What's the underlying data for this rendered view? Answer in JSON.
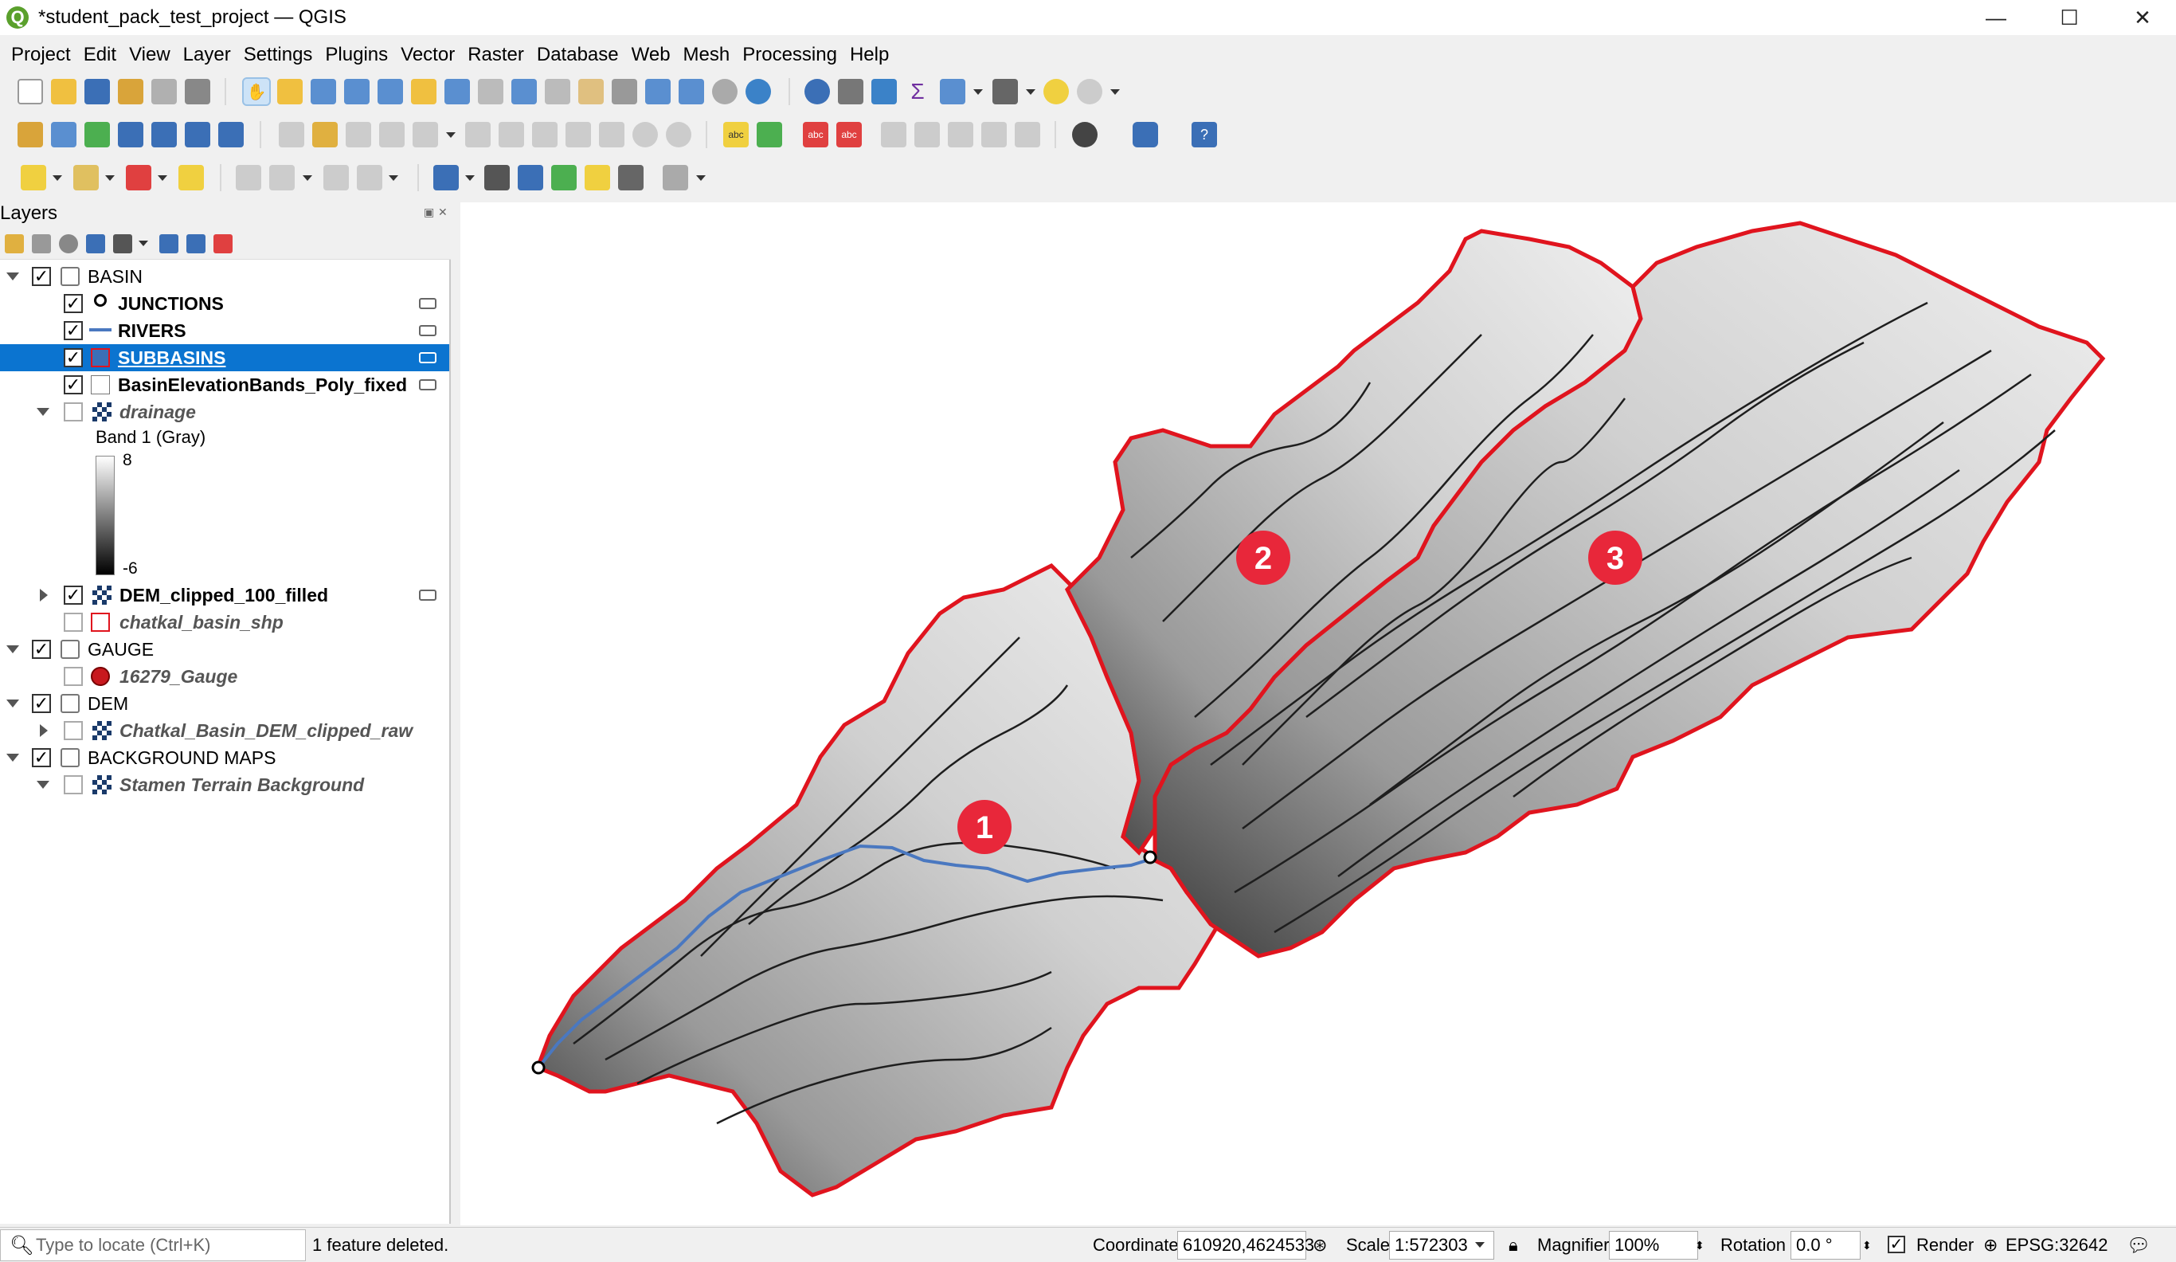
{
  "window": {
    "title": "*student_pack_test_project — QGIS",
    "app_icon": "Q",
    "controls": {
      "minimize": "—",
      "maximize": "☐",
      "close": "✕"
    }
  },
  "menu": [
    "Project",
    "Edit",
    "View",
    "Layer",
    "Settings",
    "Plugins",
    "Vector",
    "Raster",
    "Database",
    "Web",
    "Mesh",
    "Processing",
    "Help"
  ],
  "layers_panel": {
    "title": "Layers",
    "band_label": "Band 1 (Gray)",
    "ramp_max": "8",
    "ramp_min": "-6",
    "items": [
      {
        "name": "BASIN",
        "type": "group",
        "checked": true,
        "expanded": true
      },
      {
        "name": "JUNCTIONS",
        "type": "point",
        "checked": true
      },
      {
        "name": "RIVERS",
        "type": "line",
        "checked": true
      },
      {
        "name": "SUBBASINS",
        "type": "polygon",
        "checked": true,
        "selected": true
      },
      {
        "name": "BasinElevationBands_Poly_fixed",
        "type": "polygon",
        "checked": true
      },
      {
        "name": "drainage",
        "type": "raster",
        "checked": false
      },
      {
        "name": "DEM_clipped_100_filled",
        "type": "raster",
        "checked": true
      },
      {
        "name": "chatkal_basin_shp",
        "type": "polygon",
        "checked": false
      },
      {
        "name": "GAUGE",
        "type": "group",
        "checked": true,
        "expanded": true
      },
      {
        "name": "16279_Gauge",
        "type": "point",
        "checked": false
      },
      {
        "name": "DEM",
        "type": "group",
        "checked": true,
        "expanded": true
      },
      {
        "name": "Chatkal_Basin_DEM_clipped_raw",
        "type": "raster",
        "checked": false
      },
      {
        "name": "BACKGROUND MAPS",
        "type": "group",
        "checked": true,
        "expanded": true
      },
      {
        "name": "Stamen Terrain Background",
        "type": "raster",
        "checked": false
      }
    ]
  },
  "map": {
    "subbasin_labels": [
      "1",
      "2",
      "3"
    ],
    "colors": {
      "boundary": "#e0141e",
      "river": "#4a78c0",
      "badge": "#e8273a",
      "contour": "#1e1e1e"
    }
  },
  "status": {
    "locate_placeholder": "Type to locate (Ctrl+K)",
    "message": "1 feature deleted.",
    "coordinate_label": "Coordinate",
    "coordinate_value": "610920,4624533",
    "scale_label": "Scale",
    "scale_value": "1:572303",
    "magnifier_label": "Magnifier",
    "magnifier_value": "100%",
    "rotation_label": "Rotation",
    "rotation_value": "0.0 °",
    "render_label": "Render",
    "crs": "EPSG:32642"
  }
}
